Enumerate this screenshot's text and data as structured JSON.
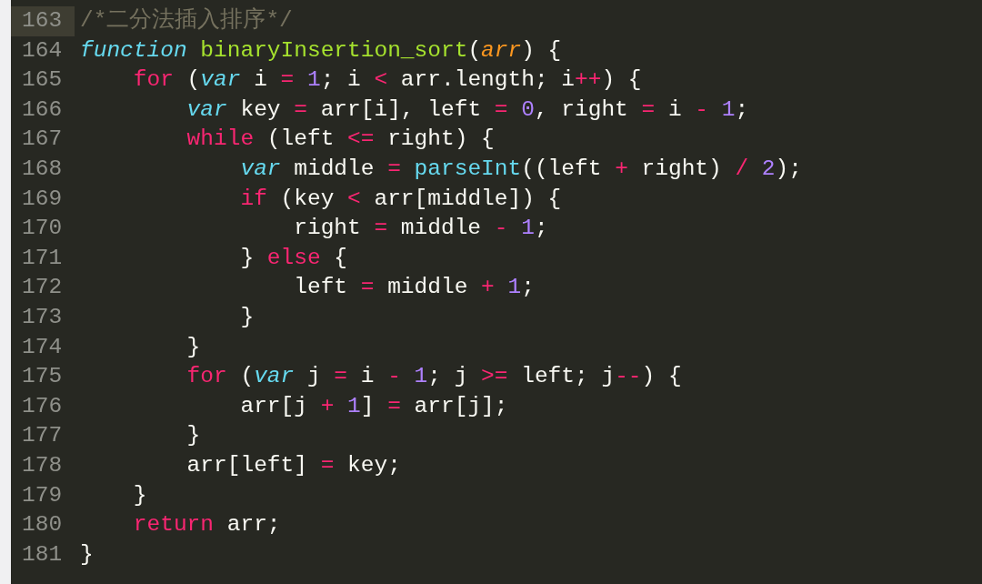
{
  "editor": {
    "lines": [
      {
        "number": "163",
        "current": true,
        "tokens": [
          {
            "kind": "comment",
            "text": "/*二分法插入排序*/"
          }
        ]
      },
      {
        "number": "164",
        "current": false,
        "tokens": [
          {
            "kind": "storage",
            "text": "function"
          },
          {
            "kind": "entity",
            "text": " binaryInsertion_sort"
          },
          {
            "kind": "plain",
            "text": "("
          },
          {
            "kind": "param",
            "text": "arr"
          },
          {
            "kind": "plain",
            "text": ") {"
          }
        ]
      },
      {
        "number": "165",
        "current": false,
        "tokens": [
          {
            "kind": "keyword",
            "text": "    for"
          },
          {
            "kind": "plain",
            "text": " ("
          },
          {
            "kind": "storage",
            "text": "var"
          },
          {
            "kind": "plain",
            "text": " i "
          },
          {
            "kind": "keyword",
            "text": "="
          },
          {
            "kind": "number",
            "text": " 1"
          },
          {
            "kind": "plain",
            "text": "; i "
          },
          {
            "kind": "keyword",
            "text": "<"
          },
          {
            "kind": "plain",
            "text": " arr.length; i"
          },
          {
            "kind": "keyword",
            "text": "++"
          },
          {
            "kind": "plain",
            "text": ") {"
          }
        ]
      },
      {
        "number": "166",
        "current": false,
        "tokens": [
          {
            "kind": "storage",
            "text": "        var"
          },
          {
            "kind": "plain",
            "text": " key "
          },
          {
            "kind": "keyword",
            "text": "="
          },
          {
            "kind": "plain",
            "text": " arr[i], left "
          },
          {
            "kind": "keyword",
            "text": "="
          },
          {
            "kind": "number",
            "text": " 0"
          },
          {
            "kind": "plain",
            "text": ", right "
          },
          {
            "kind": "keyword",
            "text": "="
          },
          {
            "kind": "plain",
            "text": " i "
          },
          {
            "kind": "keyword",
            "text": "-"
          },
          {
            "kind": "number",
            "text": " 1"
          },
          {
            "kind": "plain",
            "text": ";"
          }
        ]
      },
      {
        "number": "167",
        "current": false,
        "tokens": [
          {
            "kind": "keyword",
            "text": "        while"
          },
          {
            "kind": "plain",
            "text": " (left "
          },
          {
            "kind": "keyword",
            "text": "<="
          },
          {
            "kind": "plain",
            "text": " right) {"
          }
        ]
      },
      {
        "number": "168",
        "current": false,
        "tokens": [
          {
            "kind": "storage",
            "text": "            var"
          },
          {
            "kind": "plain",
            "text": " middle "
          },
          {
            "kind": "keyword",
            "text": "="
          },
          {
            "kind": "builtin",
            "text": " parseInt"
          },
          {
            "kind": "plain",
            "text": "((left "
          },
          {
            "kind": "keyword",
            "text": "+"
          },
          {
            "kind": "plain",
            "text": " right) "
          },
          {
            "kind": "keyword",
            "text": "/"
          },
          {
            "kind": "number",
            "text": " 2"
          },
          {
            "kind": "plain",
            "text": ");"
          }
        ]
      },
      {
        "number": "169",
        "current": false,
        "tokens": [
          {
            "kind": "keyword",
            "text": "            if"
          },
          {
            "kind": "plain",
            "text": " (key "
          },
          {
            "kind": "keyword",
            "text": "<"
          },
          {
            "kind": "plain",
            "text": " arr[middle]) {"
          }
        ]
      },
      {
        "number": "170",
        "current": false,
        "tokens": [
          {
            "kind": "plain",
            "text": "                right "
          },
          {
            "kind": "keyword",
            "text": "="
          },
          {
            "kind": "plain",
            "text": " middle "
          },
          {
            "kind": "keyword",
            "text": "-"
          },
          {
            "kind": "number",
            "text": " 1"
          },
          {
            "kind": "plain",
            "text": ";"
          }
        ]
      },
      {
        "number": "171",
        "current": false,
        "tokens": [
          {
            "kind": "plain",
            "text": "            } "
          },
          {
            "kind": "keyword",
            "text": "else"
          },
          {
            "kind": "plain",
            "text": " {"
          }
        ]
      },
      {
        "number": "172",
        "current": false,
        "tokens": [
          {
            "kind": "plain",
            "text": "                left "
          },
          {
            "kind": "keyword",
            "text": "="
          },
          {
            "kind": "plain",
            "text": " middle "
          },
          {
            "kind": "keyword",
            "text": "+"
          },
          {
            "kind": "number",
            "text": " 1"
          },
          {
            "kind": "plain",
            "text": ";"
          }
        ]
      },
      {
        "number": "173",
        "current": false,
        "tokens": [
          {
            "kind": "plain",
            "text": "            }"
          }
        ]
      },
      {
        "number": "174",
        "current": false,
        "tokens": [
          {
            "kind": "plain",
            "text": "        }"
          }
        ]
      },
      {
        "number": "175",
        "current": false,
        "tokens": [
          {
            "kind": "keyword",
            "text": "        for"
          },
          {
            "kind": "plain",
            "text": " ("
          },
          {
            "kind": "storage",
            "text": "var"
          },
          {
            "kind": "plain",
            "text": " j "
          },
          {
            "kind": "keyword",
            "text": "="
          },
          {
            "kind": "plain",
            "text": " i "
          },
          {
            "kind": "keyword",
            "text": "-"
          },
          {
            "kind": "number",
            "text": " 1"
          },
          {
            "kind": "plain",
            "text": "; j "
          },
          {
            "kind": "keyword",
            "text": ">="
          },
          {
            "kind": "plain",
            "text": " left; j"
          },
          {
            "kind": "keyword",
            "text": "--"
          },
          {
            "kind": "plain",
            "text": ") {"
          }
        ]
      },
      {
        "number": "176",
        "current": false,
        "tokens": [
          {
            "kind": "plain",
            "text": "            arr[j "
          },
          {
            "kind": "keyword",
            "text": "+"
          },
          {
            "kind": "number",
            "text": " 1"
          },
          {
            "kind": "plain",
            "text": "] "
          },
          {
            "kind": "keyword",
            "text": "="
          },
          {
            "kind": "plain",
            "text": " arr[j];"
          }
        ]
      },
      {
        "number": "177",
        "current": false,
        "tokens": [
          {
            "kind": "plain",
            "text": "        }"
          }
        ]
      },
      {
        "number": "178",
        "current": false,
        "tokens": [
          {
            "kind": "plain",
            "text": "        arr[left] "
          },
          {
            "kind": "keyword",
            "text": "="
          },
          {
            "kind": "plain",
            "text": " key;"
          }
        ]
      },
      {
        "number": "179",
        "current": false,
        "tokens": [
          {
            "kind": "plain",
            "text": "    }"
          }
        ]
      },
      {
        "number": "180",
        "current": false,
        "tokens": [
          {
            "kind": "keyword",
            "text": "    return"
          },
          {
            "kind": "plain",
            "text": " arr;"
          }
        ]
      },
      {
        "number": "181",
        "current": false,
        "tokens": [
          {
            "kind": "plain",
            "text": "}"
          }
        ]
      }
    ]
  }
}
